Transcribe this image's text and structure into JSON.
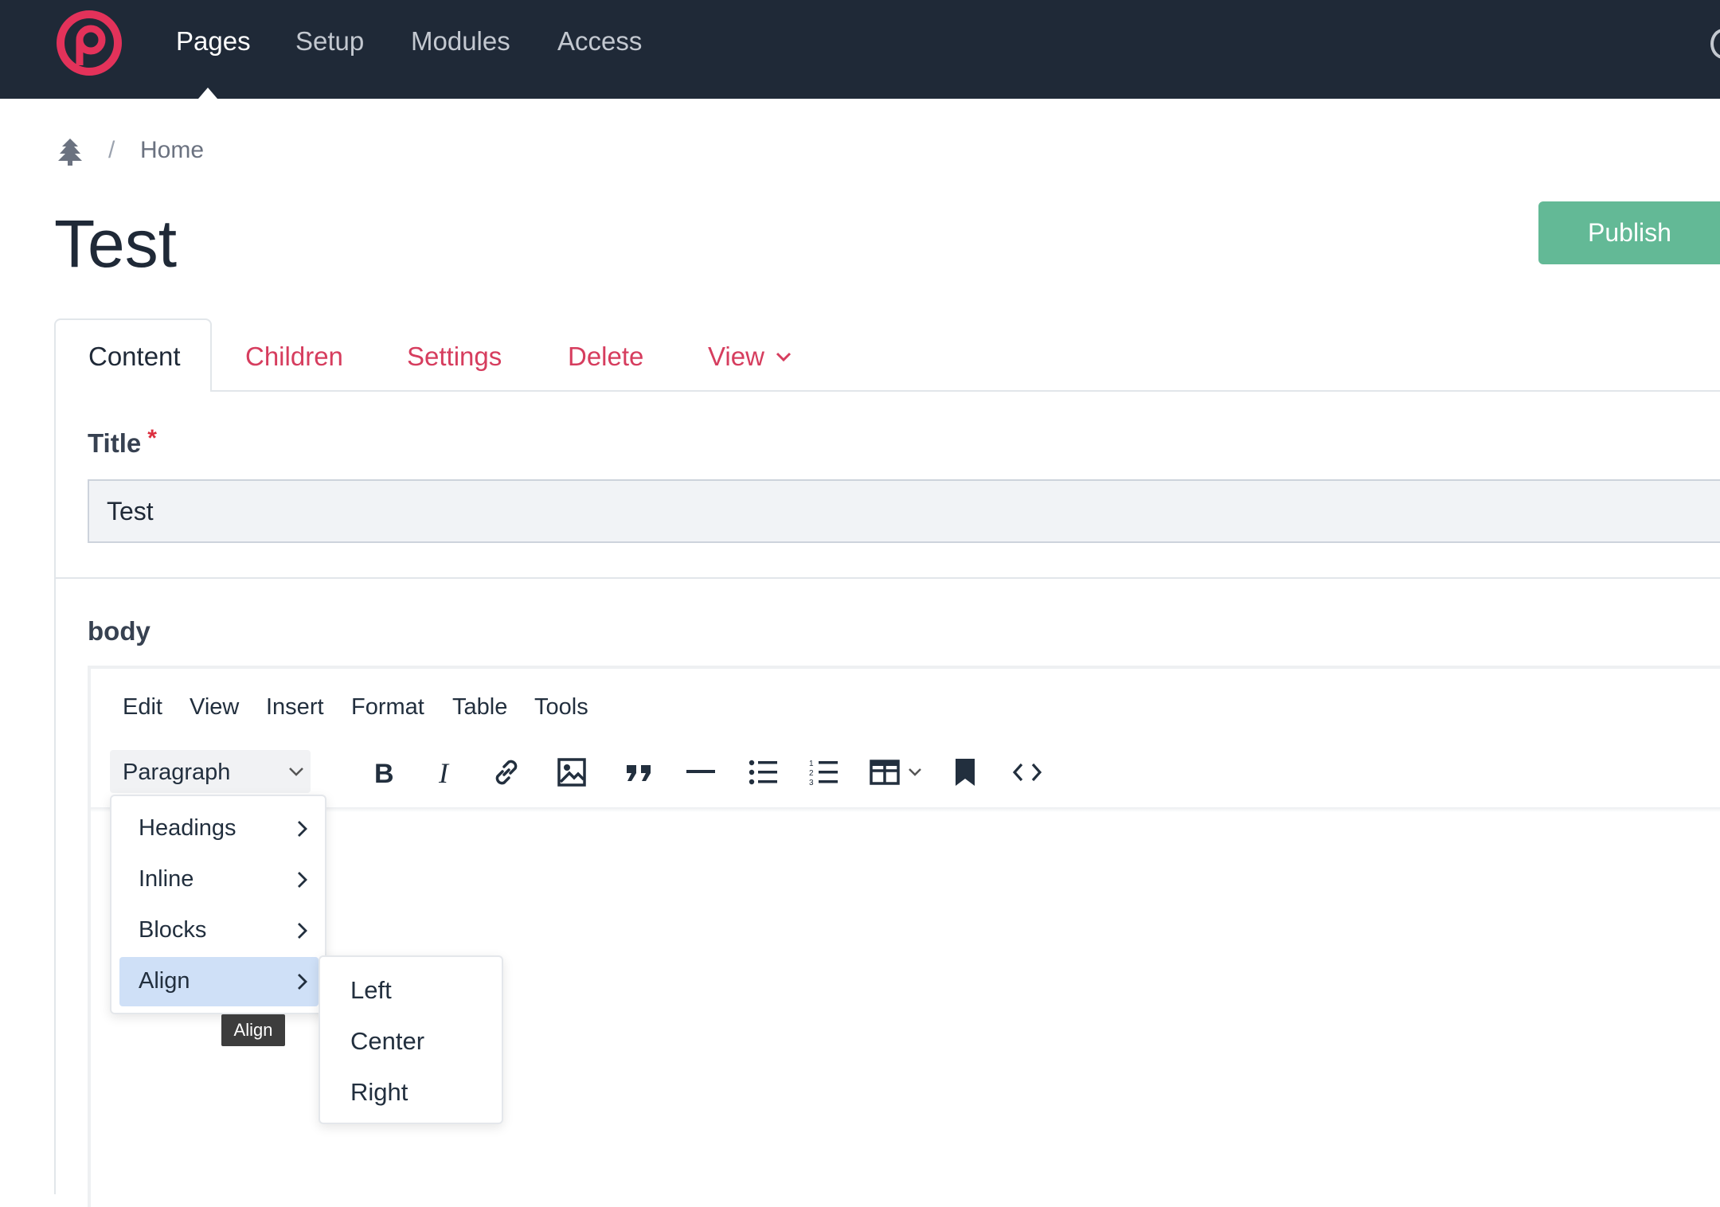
{
  "nav": {
    "items": [
      {
        "label": "Pages",
        "active": true
      },
      {
        "label": "Setup",
        "active": false
      },
      {
        "label": "Modules",
        "active": false
      },
      {
        "label": "Access",
        "active": false
      }
    ],
    "logo_color": "#e3325a"
  },
  "breadcrumb": {
    "root_icon": "tree-icon",
    "separator": "/",
    "items": [
      "Home"
    ]
  },
  "page": {
    "title": "Test",
    "publish_label": "Publish",
    "publish_color": "#63b996"
  },
  "tabs": [
    {
      "label": "Content",
      "active": true
    },
    {
      "label": "Children",
      "active": false
    },
    {
      "label": "Settings",
      "active": false
    },
    {
      "label": "Delete",
      "active": false
    },
    {
      "label": "View",
      "active": false,
      "has_dropdown": true
    }
  ],
  "fields": {
    "title_label": "Title",
    "required_marker": "*",
    "title_value": "Test",
    "body_label": "body"
  },
  "editor": {
    "menu": [
      "Edit",
      "View",
      "Insert",
      "Format",
      "Table",
      "Tools"
    ],
    "block_format": "Paragraph",
    "toolbar_icons": [
      "bold-icon",
      "italic-icon",
      "link-icon",
      "image-icon",
      "blockquote-icon",
      "horizontal-rule-icon",
      "bullet-list-icon",
      "numbered-list-icon",
      "table-icon",
      "bookmark-icon",
      "source-code-icon"
    ],
    "format_menu": [
      {
        "label": "Headings",
        "highlighted": false
      },
      {
        "label": "Inline",
        "highlighted": false
      },
      {
        "label": "Blocks",
        "highlighted": false
      },
      {
        "label": "Align",
        "highlighted": true
      }
    ],
    "align_submenu": [
      "Left",
      "Center",
      "Right"
    ],
    "tooltip": "Align"
  }
}
